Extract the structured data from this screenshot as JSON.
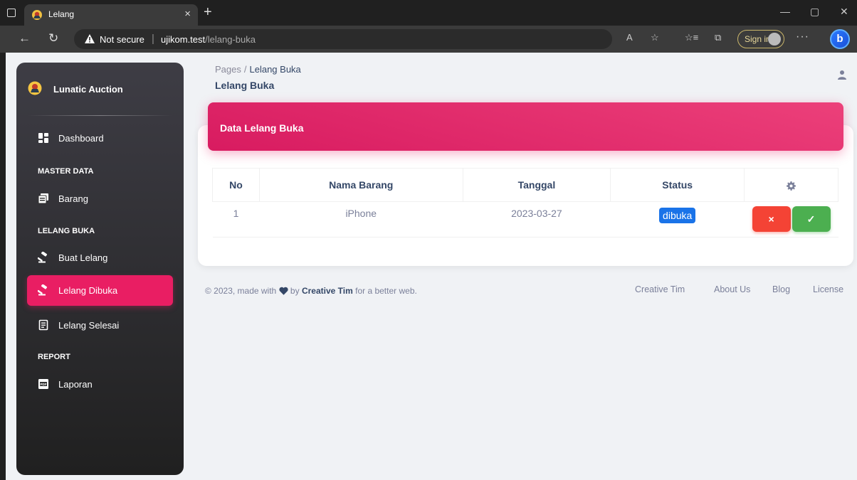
{
  "browser": {
    "tab_title": "Lelang",
    "tab_close": "×",
    "new_tab": "+",
    "security_label": "Not secure",
    "url_separator": "|",
    "url_host": "ujikom.test",
    "url_path": "/lelang-buka",
    "signin_label": "Sign in",
    "more_label": "···",
    "bing_label": "b",
    "window_controls": {
      "minimize": "—",
      "restore": "▢",
      "close": "✕"
    },
    "nav": {
      "back": "←",
      "refresh": "↻"
    },
    "tools": {
      "read_aloud": "A",
      "favorite": "☆",
      "favorites": "☆≡",
      "collections": "⧉"
    },
    "colors": {
      "chrome_bg": "#202020",
      "toolbar_bg": "#3b3b3b",
      "signin_border": "#c9b56a"
    }
  },
  "sidebar": {
    "brand_name": "Lunatic Auction",
    "items": [
      {
        "label": "Dashboard",
        "icon": "dashboard-icon"
      },
      {
        "label": "Barang",
        "icon": "collection-icon"
      },
      {
        "label": "Buat Lelang",
        "icon": "gavel-icon"
      },
      {
        "label": "Lelang Dibuka",
        "icon": "gavel-icon",
        "active": true
      },
      {
        "label": "Lelang Selesai",
        "icon": "receipt-icon"
      },
      {
        "label": "Laporan",
        "icon": "pdf-icon"
      }
    ],
    "sections": [
      "MASTER DATA",
      "LELANG BUKA",
      "REPORT"
    ]
  },
  "header": {
    "breadcrumb_root": "Pages",
    "breadcrumb_sep": "/",
    "breadcrumb_current": "Lelang Buka",
    "page_title": "Lelang Buka"
  },
  "card": {
    "title": "Data Lelang Buka",
    "table": {
      "headers": [
        "No",
        "Nama Barang",
        "Tanggal",
        "Status"
      ],
      "rows": [
        {
          "no": "1",
          "nama_barang": "iPhone",
          "tanggal": "2023-03-27",
          "status": "dibuka"
        }
      ],
      "reject_label": "×",
      "accept_label": "✓"
    }
  },
  "footer": {
    "copyright_prefix": "© 2023, made with",
    "by": "by",
    "author": "Creative Tim",
    "suffix": "for a better web.",
    "links": [
      "Creative Tim",
      "About Us",
      "Blog",
      "License"
    ]
  },
  "colors": {
    "accent": "#e91e63",
    "badge_blue": "#1a73e8",
    "button_red": "#f44335",
    "button_green": "#4caf50",
    "text_dark": "#344767",
    "text_muted": "#7b809a"
  }
}
